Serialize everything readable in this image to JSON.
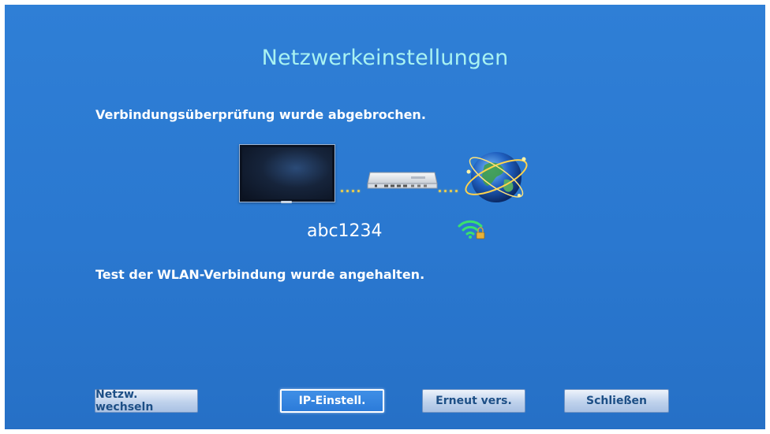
{
  "dialog": {
    "title": "Netzwerkeinstellungen",
    "status_connection": "Verbindungsüberprüfung wurde abgebrochen.",
    "status_wlan": "Test der WLAN-Verbindung wurde angehalten."
  },
  "diagram": {
    "device": "tv-icon",
    "router": "router-icon",
    "internet": "globe-icon",
    "network_name": "abc1234",
    "signal_icon": "wifi-locked-icon"
  },
  "buttons": {
    "change_network": "Netzw. wechseln",
    "ip_settings": "IP-Einstell.",
    "retry": "Erneut vers.",
    "close": "Schließen",
    "selected": "ip_settings"
  },
  "colors": {
    "background": "#2b79d1",
    "title": "#a8f2f2",
    "link_dots": "#f2d14a",
    "wifi_signal": "#39e06e"
  }
}
